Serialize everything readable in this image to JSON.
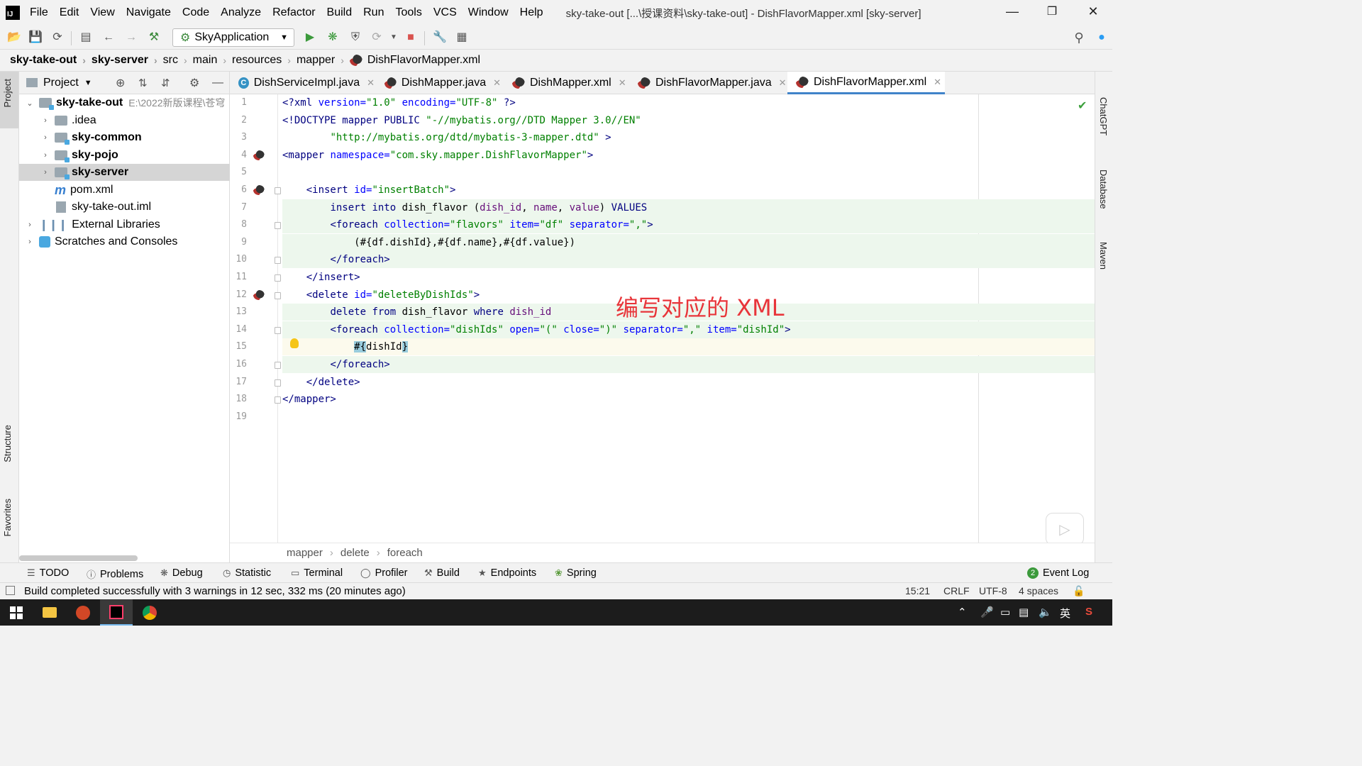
{
  "menubar": {
    "items": [
      "File",
      "Edit",
      "View",
      "Navigate",
      "Code",
      "Analyze",
      "Refactor",
      "Build",
      "Run",
      "Tools",
      "VCS",
      "Window",
      "Help"
    ],
    "window_title": "sky-take-out [...\\授课资料\\sky-take-out] - DishFlavorMapper.xml [sky-server]"
  },
  "toolbar": {
    "run_config": "SkyApplication"
  },
  "breadcrumb": [
    "sky-take-out",
    "sky-server",
    "src",
    "main",
    "resources",
    "mapper",
    "DishFlavorMapper.xml"
  ],
  "left_strip": {
    "project": "Project",
    "structure": "Structure",
    "favorites": "Favorites"
  },
  "right_strip": {
    "chatgpt": "ChatGPT",
    "database": "Database",
    "maven": "Maven"
  },
  "project_panel": {
    "title": "Project",
    "tree": [
      {
        "label": "sky-take-out",
        "hint": "E:\\2022新版课程\\苍穹"
      },
      {
        "label": ".idea"
      },
      {
        "label": "sky-common"
      },
      {
        "label": "sky-pojo"
      },
      {
        "label": "sky-server"
      },
      {
        "label": "pom.xml"
      },
      {
        "label": "sky-take-out.iml"
      },
      {
        "label": "External Libraries"
      },
      {
        "label": "Scratches and Consoles"
      }
    ]
  },
  "tabs": [
    {
      "label": "DishServiceImpl.java"
    },
    {
      "label": "DishMapper.java"
    },
    {
      "label": "DishMapper.xml"
    },
    {
      "label": "DishFlavorMapper.java"
    },
    {
      "label": "DishFlavorMapper.xml",
      "active": true
    }
  ],
  "editor": {
    "line_numbers": [
      "1",
      "2",
      "3",
      "4",
      "5",
      "6",
      "7",
      "8",
      "9",
      "10",
      "11",
      "12",
      "13",
      "14",
      "15",
      "16",
      "17",
      "18",
      "19"
    ],
    "overlay_note": "编写对应的 XML"
  },
  "editor_crumbs": [
    "mapper",
    "delete",
    "foreach"
  ],
  "toolwindows": [
    "TODO",
    "Problems",
    "Debug",
    "Statistic",
    "Terminal",
    "Profiler",
    "Build",
    "Endpoints",
    "Spring",
    "Event Log"
  ],
  "event_log_count": "2",
  "status": {
    "message": "Build completed successfully with 3 warnings in 12 sec, 332 ms (20 minutes ago)",
    "position": "15:21",
    "line_sep": "CRLF",
    "encoding": "UTF-8",
    "indent": "4 spaces"
  },
  "taskbar": {
    "ime": "英"
  }
}
